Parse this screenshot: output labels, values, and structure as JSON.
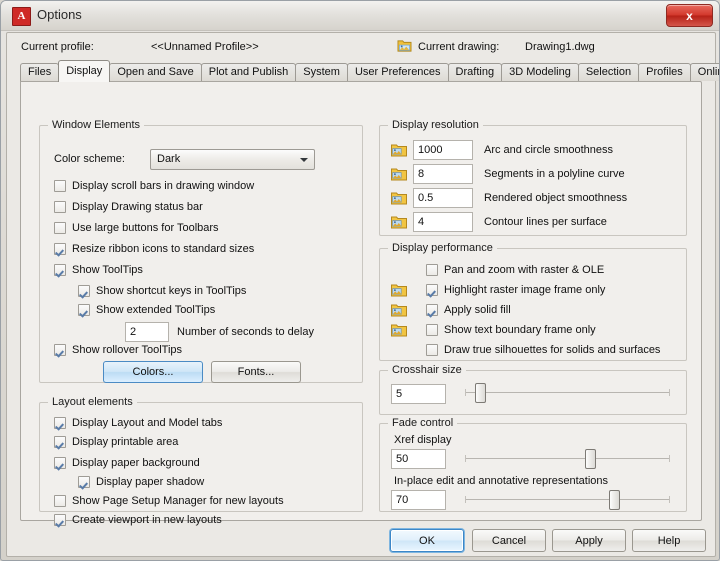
{
  "window": {
    "title": "Options",
    "app_icon": "autocad-a-icon",
    "close_label": "x"
  },
  "profile": {
    "current_profile_label": "Current profile:",
    "current_profile_value": "<<Unnamed Profile>>",
    "current_drawing_label": "Current drawing:",
    "current_drawing_value": "Drawing1.dwg"
  },
  "tabs": [
    {
      "label": "Files",
      "active": false
    },
    {
      "label": "Display",
      "active": true
    },
    {
      "label": "Open and Save",
      "active": false
    },
    {
      "label": "Plot and Publish",
      "active": false
    },
    {
      "label": "System",
      "active": false
    },
    {
      "label": "User Preferences",
      "active": false
    },
    {
      "label": "Drafting",
      "active": false
    },
    {
      "label": "3D Modeling",
      "active": false
    },
    {
      "label": "Selection",
      "active": false
    },
    {
      "label": "Profiles",
      "active": false
    },
    {
      "label": "Online",
      "active": false
    }
  ],
  "window_elements": {
    "title": "Window Elements",
    "color_scheme_label": "Color scheme:",
    "color_scheme_value": "Dark",
    "checkboxes": [
      {
        "label": "Display scroll bars in drawing window",
        "checked": false
      },
      {
        "label": "Display Drawing status bar",
        "checked": false
      },
      {
        "label": "Use large buttons for Toolbars",
        "checked": false
      },
      {
        "label": "Resize ribbon icons to standard sizes",
        "checked": true
      },
      {
        "label": "Show ToolTips",
        "checked": true
      },
      {
        "label": "Show shortcut keys in ToolTips",
        "checked": true
      },
      {
        "label": "Show extended ToolTips",
        "checked": true
      },
      {
        "label": "Show rollover ToolTips",
        "checked": true
      }
    ],
    "delay_value": "2",
    "delay_label": "Number of seconds to delay",
    "colors_button": "Colors...",
    "fonts_button": "Fonts..."
  },
  "layout_elements": {
    "title": "Layout elements",
    "checkboxes": [
      {
        "label": "Display Layout and Model tabs",
        "checked": true
      },
      {
        "label": "Display printable area",
        "checked": true
      },
      {
        "label": "Display paper background",
        "checked": true
      },
      {
        "label": "Display paper shadow",
        "checked": true
      },
      {
        "label": "Show Page Setup Manager for new layouts",
        "checked": false
      },
      {
        "label": "Create viewport in new layouts",
        "checked": true
      }
    ]
  },
  "display_resolution": {
    "title": "Display resolution",
    "rows": [
      {
        "value": "1000",
        "label": "Arc and circle smoothness"
      },
      {
        "value": "8",
        "label": "Segments in a polyline curve"
      },
      {
        "value": "0.5",
        "label": "Rendered object smoothness"
      },
      {
        "value": "4",
        "label": "Contour lines per surface"
      }
    ]
  },
  "display_performance": {
    "title": "Display performance",
    "checkboxes": [
      {
        "label": "Pan and zoom with raster & OLE",
        "checked": false,
        "icon": false
      },
      {
        "label": "Highlight raster image frame only",
        "checked": true,
        "icon": true
      },
      {
        "label": "Apply solid fill",
        "checked": true,
        "icon": true
      },
      {
        "label": "Show text boundary frame only",
        "checked": false,
        "icon": true
      },
      {
        "label": "Draw true silhouettes for solids and surfaces",
        "checked": false,
        "icon": false
      }
    ]
  },
  "crosshair": {
    "title": "Crosshair size",
    "value": "5",
    "slider_percent": 5
  },
  "fade_control": {
    "title": "Fade control",
    "xref_label": "Xref display",
    "xref_value": "50",
    "xref_slider_percent": 62,
    "inplace_label": "In-place edit and annotative representations",
    "inplace_value": "70",
    "inplace_slider_percent": 74
  },
  "buttons": {
    "ok": "OK",
    "cancel": "Cancel",
    "apply": "Apply",
    "help": "Help"
  },
  "colors": {
    "accent": "#3c87c8",
    "titlebar_close": "#d2382c",
    "app_icon": "#cf2a27",
    "checkmark": "#5a7ca8"
  }
}
